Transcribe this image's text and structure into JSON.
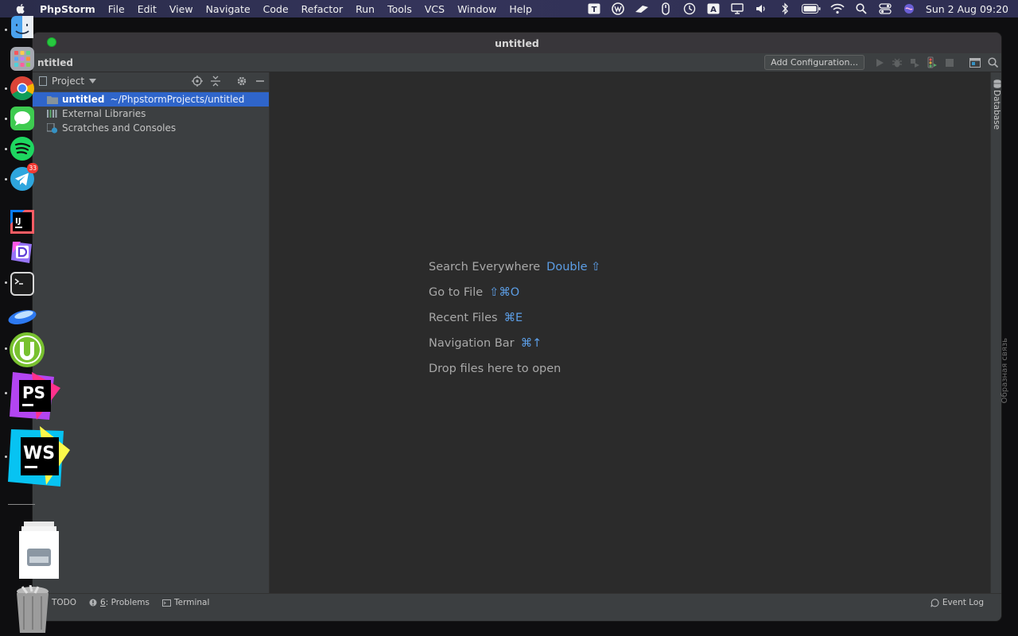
{
  "menubar": {
    "app_name": "PhpStorm",
    "items": [
      "File",
      "Edit",
      "View",
      "Navigate",
      "Code",
      "Refactor",
      "Run",
      "Tools",
      "VCS",
      "Window",
      "Help"
    ],
    "clock": "Sun 2 Aug  09:20"
  },
  "window": {
    "title": "untitled",
    "breadcrumb": "ntitled",
    "add_configuration": "Add Configuration..."
  },
  "project_panel": {
    "title": "Project",
    "tree": [
      {
        "name": "untitled",
        "path": "~/PhpstormProjects/untitled",
        "selected": true
      },
      {
        "name": "External Libraries"
      },
      {
        "name": "Scratches and Consoles"
      }
    ]
  },
  "editor": {
    "hints": [
      {
        "label": "Search Everywhere",
        "shortcut": "Double ⇧"
      },
      {
        "label": "Go to File",
        "shortcut": "⇧⌘O"
      },
      {
        "label": "Recent Files",
        "shortcut": "⌘E"
      },
      {
        "label": "Navigation Bar",
        "shortcut": "⌘↑"
      },
      {
        "label": "Drop files here to open",
        "shortcut": ""
      }
    ]
  },
  "right_stripe": {
    "database": "Database"
  },
  "bottombar": {
    "todo": "TODO",
    "problems_num": "6",
    "problems_label": ": Problems",
    "terminal": "Terminal",
    "event_log": "Event Log"
  },
  "dock": {
    "telegram_badge": "33",
    "ghost_text": "Образная связь"
  },
  "colors": {
    "accent_link": "#5c9ee6",
    "selection": "#2f65ca",
    "editor_bg": "#2b2b2b",
    "panel_bg": "#3c3f41"
  }
}
